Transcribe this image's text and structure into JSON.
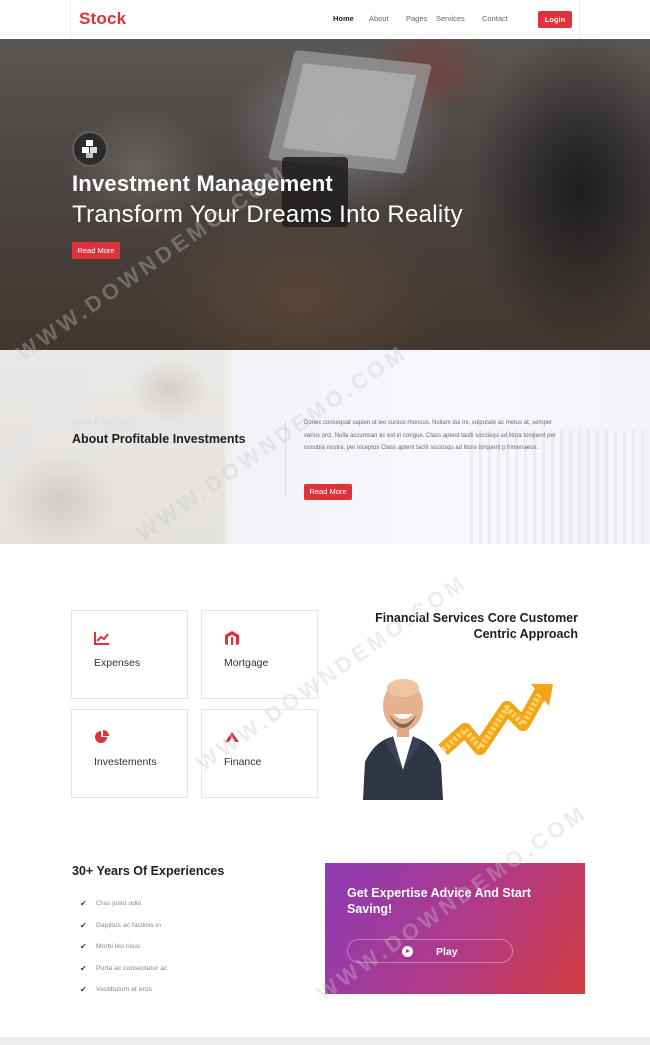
{
  "nav": {
    "logo": "Stock",
    "menu": [
      "Home",
      "About",
      "Pages",
      "Services",
      "Contact"
    ],
    "login": "Login"
  },
  "hero": {
    "title": "Investment Management",
    "subtitle": "Transform Your Dreams Into Reality",
    "button": "Read More"
  },
  "about": {
    "eyebrow": "WHAT WE DO",
    "title": "About Profitable Investments",
    "text": "Donec consequat sapien ut leo cursus rhoncus. Nullam dui mi, vulputate ac metus at, semper varius orci. Nulla accumsan ac est in congue. Class aptent taciti sociosqu ad litora torquent per conubia nostra, per inceptos Class aptent taciti sociosqu ad litora torquent p himenaeos.",
    "button": "Read More"
  },
  "services": {
    "cards": [
      {
        "label": "Expenses",
        "icon": "line-chart-icon"
      },
      {
        "label": "Mortgage",
        "icon": "magento-icon"
      },
      {
        "label": "Investements",
        "icon": "pie-chart-icon"
      },
      {
        "label": "Finance",
        "icon": "finance-icon"
      }
    ],
    "core_title": "Financial Services Core Customer Centric Approach"
  },
  "experience": {
    "title": "30+ Years Of Experiences",
    "items": [
      "Cras justo odio",
      "Dapibus ac facilisis in",
      "Morbi leo risus",
      "Porta ac consectetur ac",
      "Vestibulum at eros"
    ]
  },
  "cta": {
    "title": "Get Expertise Advice And Start Saving!",
    "play_label": "Play"
  },
  "watermark": "WWW.DOWNDEMO.COM",
  "colors": {
    "accent": "#e0323a",
    "cta_start": "#8d3bb5",
    "cta_end": "#d23c3e"
  }
}
